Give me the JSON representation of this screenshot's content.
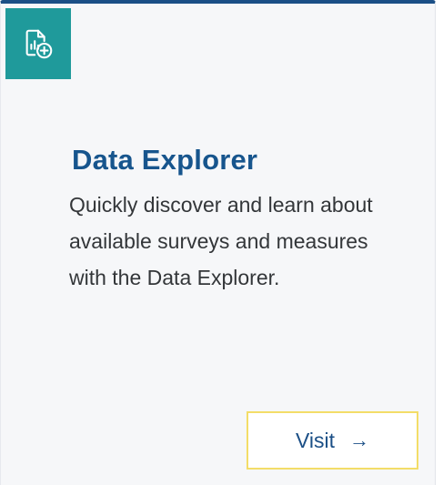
{
  "card": {
    "icon": "report-add-icon",
    "title": "Data Explorer",
    "description": "Quickly discover and learn about available surveys and measures with the Data Explorer.",
    "button": {
      "label": "Visit",
      "icon": "arrow-right-icon",
      "arrow_glyph": "→"
    }
  },
  "colors": {
    "accent_top": "#1b4f86",
    "icon_tile": "#1f9a9b",
    "title": "#17558d",
    "button_border": "#f3dd68",
    "card_bg": "#f6f7f9"
  }
}
